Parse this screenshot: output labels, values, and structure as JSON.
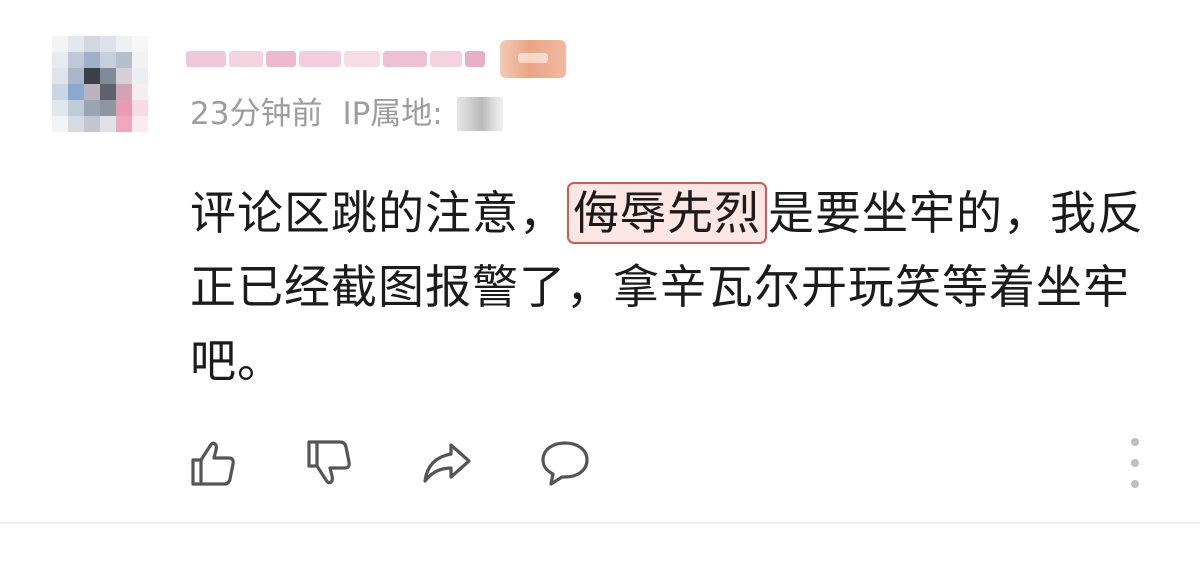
{
  "comment": {
    "time": "23分钟前",
    "ip_label": "IP属地:",
    "text_before": "评论区跳的注意，",
    "highlight": "侮辱先烈",
    "text_after": "是要坐牢的，我反正已经截图报警了，拿辛瓦尔开玩笑等着坐牢吧。"
  },
  "actions": {
    "like_icon": "thumbs-up-icon",
    "dislike_icon": "thumbs-down-icon",
    "share_icon": "share-arrow-icon",
    "reply_icon": "speech-bubble-icon",
    "more_icon": "vertical-dots-icon"
  },
  "colors": {
    "highlight_border": "#d35a52",
    "highlight_fill": "#fde6e3",
    "meta_text": "#9d9d9d",
    "body_text": "#1b1b1b",
    "icon_stroke": "#555555"
  }
}
